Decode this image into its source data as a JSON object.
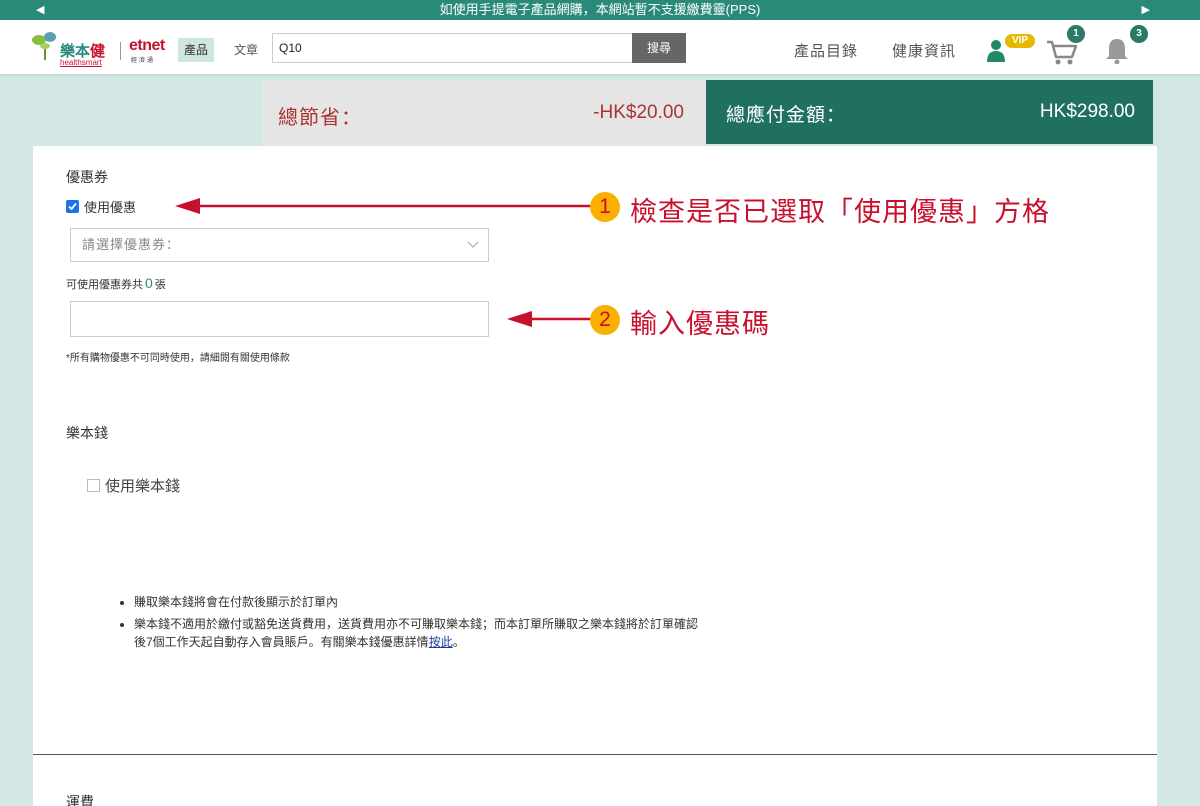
{
  "announcement": "如使用手提電子產品網購，本網站暫不支援繳費靈(PPS)",
  "header": {
    "logo_text_a": "樂本",
    "logo_text_b": "健",
    "logo_sub": "healthsmart",
    "partner": "etnet",
    "partner_sub": "經濟通",
    "segment_products": "產品",
    "segment_articles": "文章",
    "search_value": "Q10",
    "search_button": "搜尋",
    "nav_catalog": "產品目錄",
    "nav_health": "健康資訊",
    "vip_label": "VIP",
    "cart_count": "1",
    "notification_count": "3"
  },
  "summary": {
    "savings_label": "總節省：",
    "savings_value": "-HK$20.00",
    "total_label": "總應付金額：",
    "total_value": "HK$298.00"
  },
  "coupon": {
    "heading": "優惠券",
    "use_offer_label": "使用優惠",
    "use_offer_checked": true,
    "select_placeholder": "請選擇優惠券：",
    "count_prefix": "可使用優惠券共",
    "count_value": "0",
    "count_suffix": "張",
    "code_value": "",
    "disclaimer": "*所有購物優惠不可同時使用，請細閱有關使用條款"
  },
  "points": {
    "heading": "樂本錢",
    "use_label": "使用樂本錢",
    "use_checked": false,
    "bullet_1": "賺取樂本錢將會在付款後顯示於訂單內",
    "bullet_2": "樂本錢不適用於繳付或豁免送貨費用，送貨費用亦不可賺取樂本錢；而本訂單所賺取之樂本錢將於訂單確認後7個工作天起自動存入會員賬戶。有關樂本錢優惠詳情",
    "bullet_2_link": "按此",
    "bullet_2_end": "。"
  },
  "shipping": {
    "heading": "運費"
  },
  "annotations": [
    {
      "number": "1",
      "text": "檢查是否已選取「使用優惠」方格"
    },
    {
      "number": "2",
      "text": "輸入優惠碼"
    }
  ],
  "colors": {
    "brand": "#2a8a7a",
    "total_bg": "#207060",
    "annotation_red": "#c8102e",
    "annotation_badge": "#f9b000"
  }
}
